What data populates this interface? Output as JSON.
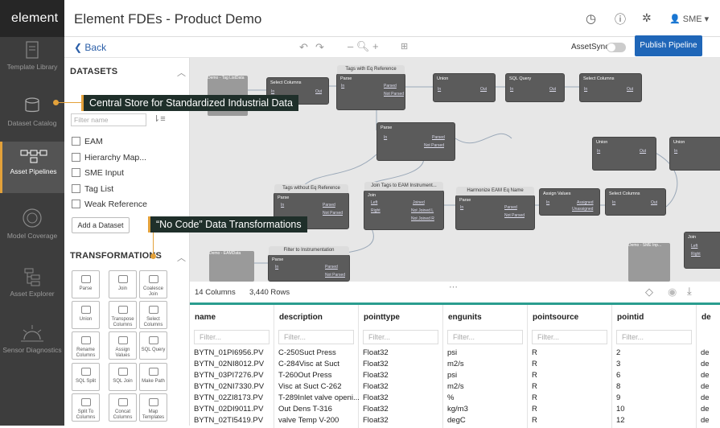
{
  "app": {
    "logo": "element",
    "title": "Element FDEs - Product Demo",
    "user": "SME"
  },
  "nav": [
    {
      "label": "Template Library"
    },
    {
      "label": "Dataset Catalog"
    },
    {
      "label": "Asset Pipelines"
    },
    {
      "label": "Model Coverage"
    },
    {
      "label": "Asset Explorer"
    },
    {
      "label": "Sensor Diagnostics"
    }
  ],
  "toolbar": {
    "back": "Back",
    "asset_sync": "AssetSync",
    "publish": "Publish Pipeline"
  },
  "left": {
    "datasets_title": "DATASETS",
    "filter_placeholder": "Filter name",
    "datasets": [
      "EAM",
      "Hierarchy Map...",
      "SME Input",
      "Tag List",
      "Weak Reference"
    ],
    "add_dataset": "Add a Dataset",
    "transformations_title": "TRANSFORMATIONS",
    "tiles": [
      "Parse",
      "Join",
      "Coalesce Join",
      "Union",
      "Transpose Columns",
      "Select Columns",
      "Rename Columns",
      "Assign Values",
      "SQL Query",
      "SQL Split",
      "SQL Join",
      "Make Path",
      "Split To Columns",
      "Concat Columns",
      "Map Templates"
    ]
  },
  "callouts": {
    "central": "Central Store for Standardized Industrial Data",
    "nocode": "“No Code” Data Transformations"
  },
  "nodes": {
    "tag_list": "Demo - Tag List",
    "select_columns": "Select Columns",
    "tags_with_eq": "Tags with Eq Reference",
    "parse": "Parse",
    "union": "Union",
    "sql_query": "SQL Query",
    "tags_without_eq": "Tags without Eq Reference",
    "join_tags": "Join Tags to EAM Instrument...",
    "harmonize": "Harmonize EAM Eq Name",
    "assign_values": "Assign Values",
    "demo_eam": "Demo - EAM",
    "filter_instr": "Filter to Instrumentation",
    "demo_sme": "Demo - SME Inp...",
    "join": "Join",
    "in": "In",
    "out": "Out",
    "data": "Data",
    "parsed": "Parsed",
    "not_parsed": "Not Parsed",
    "left": "Left",
    "right": "Right",
    "joined": "Joined",
    "not_joined_l": "Not Joined L",
    "not_joined_r": "Not Joined R",
    "assigned": "Assigned",
    "unassigned": "Unassigned"
  },
  "grid": {
    "columns_count": "14 Columns",
    "rows_count": "3,440 Rows",
    "filter": "Filter...",
    "headers": [
      "name",
      "description",
      "pointtype",
      "engunits",
      "pointsource",
      "pointid",
      "de"
    ],
    "rows": [
      [
        "BYTN_01PI6956.PV",
        "C-250Suct Press",
        "Float32",
        "psi",
        "R",
        "2",
        "de"
      ],
      [
        "BYTN_02NI8012.PV",
        "C-284Visc at Suct",
        "Float32",
        "m2/s",
        "R",
        "3",
        "de"
      ],
      [
        "BYTN_03PI7276.PV",
        "T-260Out Press",
        "Float32",
        "psi",
        "R",
        "6",
        "de"
      ],
      [
        "BYTN_02NI7330.PV",
        "Visc at Suct C-262",
        "Float32",
        "m2/s",
        "R",
        "8",
        "de"
      ],
      [
        "BYTN_02ZI8173.PV",
        "T-289Inlet valve openi...",
        "Float32",
        "%",
        "R",
        "9",
        "de"
      ],
      [
        "BYTN_02DI9011.PV",
        "Out Dens T-316",
        "Float32",
        "kg/m3",
        "R",
        "10",
        "de"
      ],
      [
        "BYTN_02TI5419.PV",
        "valve Temp V-200",
        "Float32",
        "degC",
        "R",
        "12",
        "de"
      ]
    ]
  }
}
